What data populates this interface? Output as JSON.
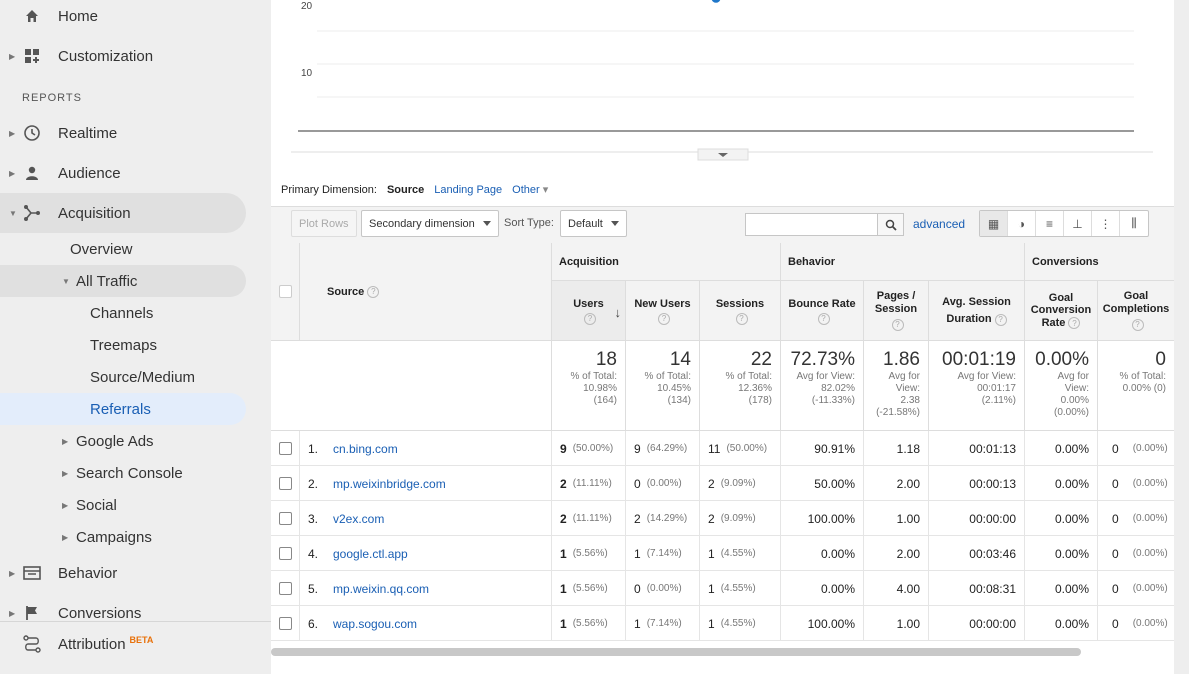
{
  "sidebar": {
    "home": "Home",
    "customization": "Customization",
    "reports_label": "REPORTS",
    "realtime": "Realtime",
    "audience": "Audience",
    "acquisition": "Acquisition",
    "overview": "Overview",
    "all_traffic": "All Traffic",
    "channels": "Channels",
    "treemaps": "Treemaps",
    "source_medium": "Source/Medium",
    "referrals": "Referrals",
    "google_ads": "Google Ads",
    "search_console": "Search Console",
    "social": "Social",
    "campaigns": "Campaigns",
    "behavior": "Behavior",
    "conversions": "Conversions",
    "attribution": "Attribution",
    "beta": "BETA"
  },
  "chart_data": {
    "type": "line",
    "y_ticks": [
      "20",
      "10"
    ],
    "points": [
      {
        "y": 21
      }
    ]
  },
  "dimension": {
    "label": "Primary Dimension:",
    "current": "Source",
    "landing": "Landing Page",
    "other": "Other"
  },
  "toolbar": {
    "plot_rows": "Plot Rows",
    "secondary": "Secondary dimension",
    "sort_label": "Sort Type:",
    "sort_value": "Default",
    "search_value": "",
    "advanced": "advanced"
  },
  "groups": {
    "acquisition": "Acquisition",
    "behavior": "Behavior",
    "conversions": "Conversions"
  },
  "columns": {
    "source": "Source",
    "users": "Users",
    "new_users": "New Users",
    "sessions": "Sessions",
    "bounce": "Bounce Rate",
    "pages1": "Pages /",
    "pages2": "Session",
    "avgdur1": "Avg. Session",
    "avgdur2": "Duration",
    "gcr1": "Goal",
    "gcr2": "Conversion",
    "gcr3": "Rate",
    "gc1": "Goal",
    "gc2": "Completions"
  },
  "totals": {
    "users": {
      "v": "18",
      "a": "% of Total:",
      "b": "10.98%",
      "c": "(164)"
    },
    "new_users": {
      "v": "14",
      "a": "% of Total:",
      "b": "10.45%",
      "c": "(134)"
    },
    "sessions": {
      "v": "22",
      "a": "% of Total:",
      "b": "12.36%",
      "c": "(178)"
    },
    "bounce": {
      "v": "72.73%",
      "a": "Avg for View:",
      "b": "82.02%",
      "c": "(-11.33%)"
    },
    "pages": {
      "v": "1.86",
      "a": "Avg for",
      "b": "View:",
      "c": "2.38",
      "d": "(-21.58%)"
    },
    "avgdur": {
      "v": "00:01:19",
      "a": "Avg for View:",
      "b": "00:01:17",
      "c": "(2.11%)"
    },
    "gcr": {
      "v": "0.00%",
      "a": "Avg for",
      "b": "View:",
      "c": "0.00%",
      "d": "(0.00%)"
    },
    "gc": {
      "v": "0",
      "a": "% of Total:",
      "b": "0.00% (0)"
    }
  },
  "rows": [
    {
      "n": "1.",
      "src": "cn.bing.com",
      "u": "9",
      "up": "(50.00%)",
      "nu": "9",
      "nup": "(64.29%)",
      "s": "11",
      "sp": "(50.00%)",
      "br": "90.91%",
      "ps": "1.18",
      "ad": "00:01:13",
      "cr": "0.00%",
      "gc": "0",
      "gcp": "(0.00%)"
    },
    {
      "n": "2.",
      "src": "mp.weixinbridge.com",
      "u": "2",
      "up": "(11.11%)",
      "nu": "0",
      "nup": "(0.00%)",
      "s": "2",
      "sp": "(9.09%)",
      "br": "50.00%",
      "ps": "2.00",
      "ad": "00:00:13",
      "cr": "0.00%",
      "gc": "0",
      "gcp": "(0.00%)"
    },
    {
      "n": "3.",
      "src": "v2ex.com",
      "u": "2",
      "up": "(11.11%)",
      "nu": "2",
      "nup": "(14.29%)",
      "s": "2",
      "sp": "(9.09%)",
      "br": "100.00%",
      "ps": "1.00",
      "ad": "00:00:00",
      "cr": "0.00%",
      "gc": "0",
      "gcp": "(0.00%)"
    },
    {
      "n": "4.",
      "src": "google.ctl.app",
      "u": "1",
      "up": "(5.56%)",
      "nu": "1",
      "nup": "(7.14%)",
      "s": "1",
      "sp": "(4.55%)",
      "br": "0.00%",
      "ps": "2.00",
      "ad": "00:03:46",
      "cr": "0.00%",
      "gc": "0",
      "gcp": "(0.00%)"
    },
    {
      "n": "5.",
      "src": "mp.weixin.qq.com",
      "u": "1",
      "up": "(5.56%)",
      "nu": "0",
      "nup": "(0.00%)",
      "s": "1",
      "sp": "(4.55%)",
      "br": "0.00%",
      "ps": "4.00",
      "ad": "00:08:31",
      "cr": "0.00%",
      "gc": "0",
      "gcp": "(0.00%)"
    },
    {
      "n": "6.",
      "src": "wap.sogou.com",
      "u": "1",
      "up": "(5.56%)",
      "nu": "1",
      "nup": "(7.14%)",
      "s": "1",
      "sp": "(4.55%)",
      "br": "100.00%",
      "ps": "1.00",
      "ad": "00:00:00",
      "cr": "0.00%",
      "gc": "0",
      "gcp": "(0.00%)"
    }
  ]
}
